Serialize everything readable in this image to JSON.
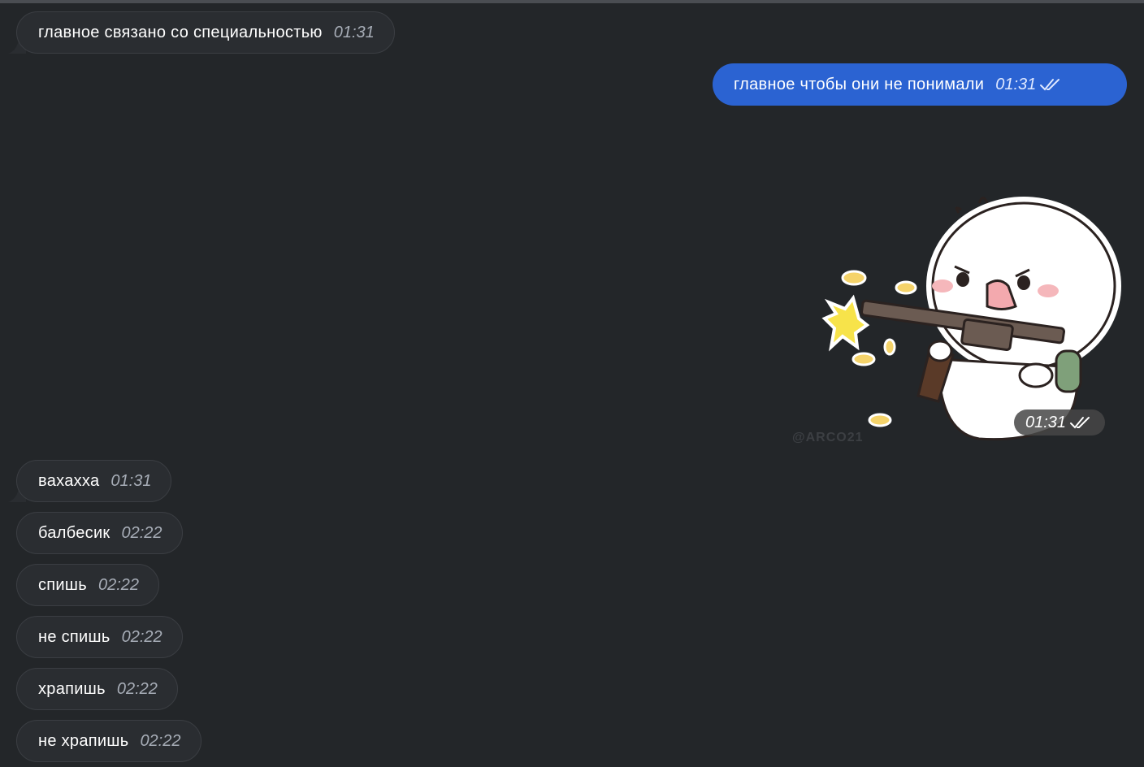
{
  "messages": [
    {
      "text": "главное связано со специальностью",
      "time": "01:31",
      "direction": "incoming"
    },
    {
      "text": "главное чтобы они не понимали",
      "time": "01:31",
      "direction": "outgoing",
      "status": "read"
    },
    {
      "type": "sticker",
      "time": "01:31",
      "direction": "outgoing",
      "status": "read",
      "watermark": "@ARCO21"
    },
    {
      "text": "вахахха",
      "time": "01:31",
      "direction": "incoming"
    },
    {
      "text": "балбесик",
      "time": "02:22",
      "direction": "incoming"
    },
    {
      "text": "спишь",
      "time": "02:22",
      "direction": "incoming"
    },
    {
      "text": "не спишь",
      "time": "02:22",
      "direction": "incoming"
    },
    {
      "text": "храпишь",
      "time": "02:22",
      "direction": "incoming"
    },
    {
      "text": "не храпишь",
      "time": "02:22",
      "direction": "incoming"
    }
  ],
  "colors": {
    "background": "#232629",
    "incoming_bubble": "#2a2d31",
    "outgoing_bubble": "#2b63d2"
  },
  "icons": {
    "read_status": "double-check-icon",
    "sticker": "white-blob-shooting-gun-sticker"
  }
}
